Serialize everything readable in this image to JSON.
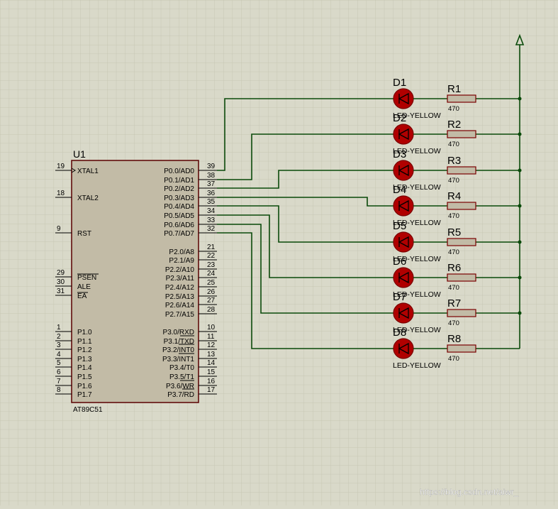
{
  "chip": {
    "ref": "U1",
    "part": "AT89C51",
    "left_pins": [
      {
        "num": "19",
        "name": "XTAL1"
      },
      {
        "num": "18",
        "name": "XTAL2"
      },
      {
        "num": "9",
        "name": "RST"
      },
      {
        "num": "29",
        "name": "PSEN"
      },
      {
        "num": "30",
        "name": "ALE"
      },
      {
        "num": "31",
        "name": "EA"
      },
      {
        "num": "1",
        "name": "P1.0"
      },
      {
        "num": "2",
        "name": "P1.1"
      },
      {
        "num": "3",
        "name": "P1.2"
      },
      {
        "num": "4",
        "name": "P1.3"
      },
      {
        "num": "5",
        "name": "P1.4"
      },
      {
        "num": "6",
        "name": "P1.5"
      },
      {
        "num": "7",
        "name": "P1.6"
      },
      {
        "num": "8",
        "name": "P1.7"
      }
    ],
    "right_pins": [
      {
        "num": "39",
        "name": "P0.0/AD0"
      },
      {
        "num": "38",
        "name": "P0.1/AD1"
      },
      {
        "num": "37",
        "name": "P0.2/AD2"
      },
      {
        "num": "36",
        "name": "P0.3/AD3"
      },
      {
        "num": "35",
        "name": "P0.4/AD4"
      },
      {
        "num": "34",
        "name": "P0.5/AD5"
      },
      {
        "num": "33",
        "name": "P0.6/AD6"
      },
      {
        "num": "32",
        "name": "P0.7/AD7"
      },
      {
        "num": "21",
        "name": "P2.0/A8"
      },
      {
        "num": "22",
        "name": "P2.1/A9"
      },
      {
        "num": "23",
        "name": "P2.2/A10"
      },
      {
        "num": "24",
        "name": "P2.3/A11"
      },
      {
        "num": "25",
        "name": "P2.4/A12"
      },
      {
        "num": "26",
        "name": "P2.5/A13"
      },
      {
        "num": "27",
        "name": "P2.6/A14"
      },
      {
        "num": "28",
        "name": "P2.7/A15"
      },
      {
        "num": "10",
        "name": "P3.0/RXD"
      },
      {
        "num": "11",
        "name": "P3.1/TXD"
      },
      {
        "num": "12",
        "name": "P3.2/INT0"
      },
      {
        "num": "13",
        "name": "P3.3/INT1"
      },
      {
        "num": "14",
        "name": "P3.4/T0"
      },
      {
        "num": "15",
        "name": "P3.5/T1"
      },
      {
        "num": "16",
        "name": "P3.6/WR"
      },
      {
        "num": "17",
        "name": "P3.7/RD"
      }
    ]
  },
  "leds": [
    {
      "ref": "D1",
      "part": "LED-YELLOW"
    },
    {
      "ref": "D2",
      "part": "LED-YELLOW"
    },
    {
      "ref": "D3",
      "part": "LED-YELLOW"
    },
    {
      "ref": "D4",
      "part": "LED-YELLOW"
    },
    {
      "ref": "D5",
      "part": "LED-YELLOW"
    },
    {
      "ref": "D6",
      "part": "LED-YELLOW"
    },
    {
      "ref": "D7",
      "part": "LED-YELLOW"
    },
    {
      "ref": "D8",
      "part": "LED-YELLOW"
    }
  ],
  "resistors": [
    {
      "ref": "R1",
      "value": "470"
    },
    {
      "ref": "R2",
      "value": "470"
    },
    {
      "ref": "R3",
      "value": "470"
    },
    {
      "ref": "R4",
      "value": "470"
    },
    {
      "ref": "R5",
      "value": "470"
    },
    {
      "ref": "R6",
      "value": "470"
    },
    {
      "ref": "R7",
      "value": "470"
    },
    {
      "ref": "R8",
      "value": "470"
    }
  ],
  "watermark": "https://blog.csdn.net/aiwr_",
  "colors": {
    "background": "#d9d9c9",
    "grid": "#c6c6b4",
    "wire": "#0a4a0a",
    "chip_fill": "#c2bba6",
    "component_outline": "#7a0000",
    "led_fill": "#b00000",
    "text": "#000000"
  }
}
